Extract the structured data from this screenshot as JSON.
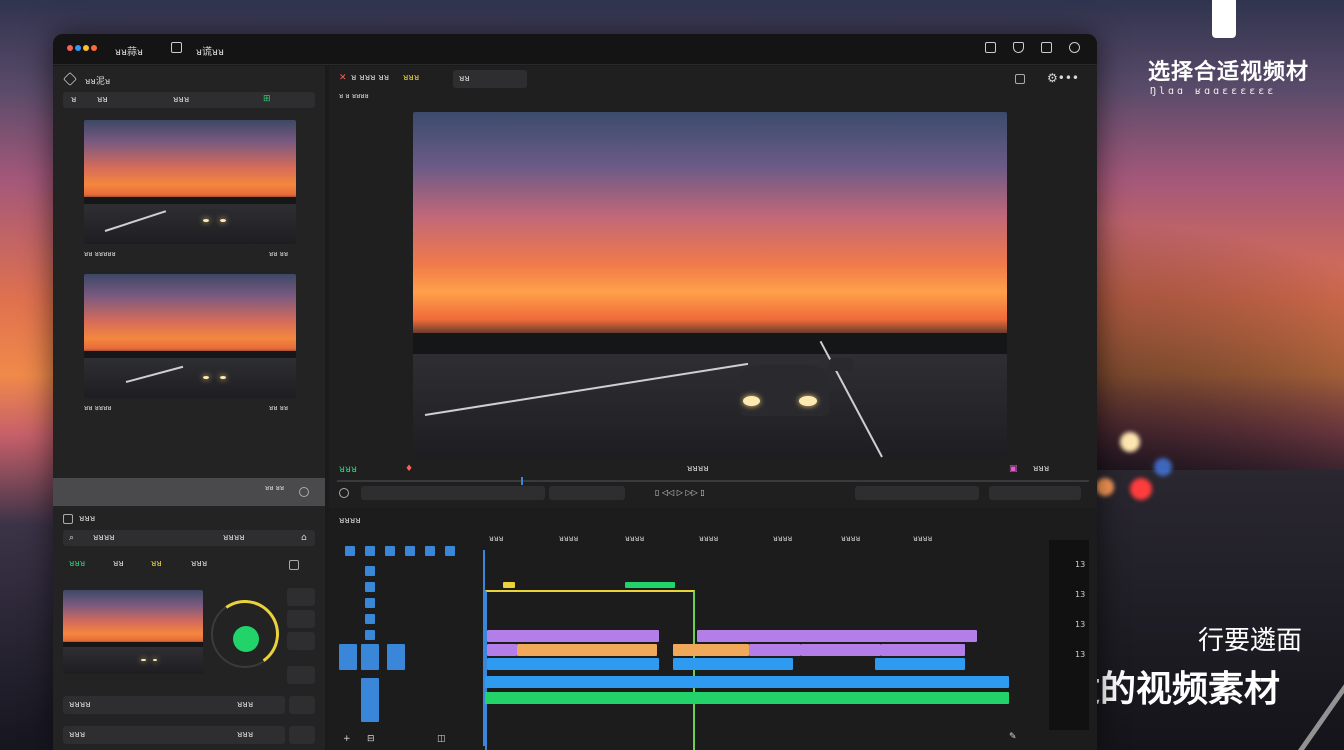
{
  "background": {
    "headline": "选择合适视频材",
    "subhead": "Ŋlɑɑ  ʁɑɑɛɛɛɛɛɛ",
    "caption_line1": "行要遴面",
    "caption_line2": "合适的视频素材",
    "colors": {
      "sky_top": "#30344e",
      "sunset": "#f08a4a",
      "text": "#ffffff"
    }
  },
  "window": {
    "titlebar": {
      "app_name": "ᴚᴚ蒜ᴚ",
      "tab_label": "ᴚ谎ᴚᴚ",
      "right_icons": [
        "save-icon",
        "shield-icon",
        "layout-icon",
        "refresh-icon"
      ]
    },
    "media_panel": {
      "title": "ᴚᴚ泥ᴚ",
      "tabs": [
        "ᴚ",
        "ᴚᴚ",
        "ᴚᴚᴚ",
        "⊞"
      ],
      "clips": [
        {
          "meta_left": "ᴚᴚ ᴚᴚᴚᴚᴚ",
          "meta_right": "ᴚᴚ ᴚᴚ"
        },
        {
          "meta_left": "ᴚᴚ ᴚᴚᴚᴚ",
          "meta_right": "ᴚᴚ ᴚᴚ"
        }
      ],
      "footer_text": "ᴚᴚ\nᴚᴚ"
    },
    "effects_panel": {
      "title": "ᴚᴚᴚ",
      "search_placeholder": "ᴚᴚᴚᴚ",
      "dropdown_label": "ᴚᴚᴚᴚ",
      "tags": [
        "ᴚᴚᴚ",
        "ᴚᴚ",
        "ᴚᴚ",
        "ᴚᴚᴚ"
      ],
      "side_labels": [
        "ᴚᴚᴚᴚ",
        "ᴚᴚᴚ"
      ],
      "footer_items": [
        "ᴚᴚᴚᴚ",
        "ᴚᴚᴚ",
        "ᴚᴚᴚ",
        "ᴚᴚᴚ"
      ],
      "dial_color": "#e9d23a",
      "record_color": "#22d36a"
    },
    "viewer": {
      "title": "ᴚ ᴚᴚᴚ ᴚᴚ",
      "title_accent": "ᴚᴚᴚ",
      "timecode": "ᴚ ᴚ ᴚᴚᴚᴚ",
      "tab": "ᴚᴚ",
      "transport_left": "ᴚᴚᴚ",
      "transport_center": "ᴚᴚᴚᴚ",
      "transport_right": "ᴚᴚᴚ",
      "accent": "#2ecc71"
    },
    "timeline": {
      "title": "ᴚᴚᴚᴚ",
      "ruler": [
        "ᴚᴚᴚ",
        "ᴚᴚᴚᴚ",
        "ᴚᴚᴚᴚ",
        "ᴚᴚᴚᴚ",
        "ᴚᴚᴚᴚ",
        "ᴚᴚᴚᴚ",
        "ᴚᴚᴚᴚ"
      ],
      "meter_labels": [
        "13",
        "13",
        "13",
        "13"
      ],
      "colors": {
        "video": "#b47ee8",
        "audio1": "#f0a85a",
        "blue": "#2f9bf0",
        "green": "#22d36a",
        "playhead": "#3a87d9",
        "selection": "#e9d23a",
        "selection2": "#6ad14a"
      }
    }
  }
}
